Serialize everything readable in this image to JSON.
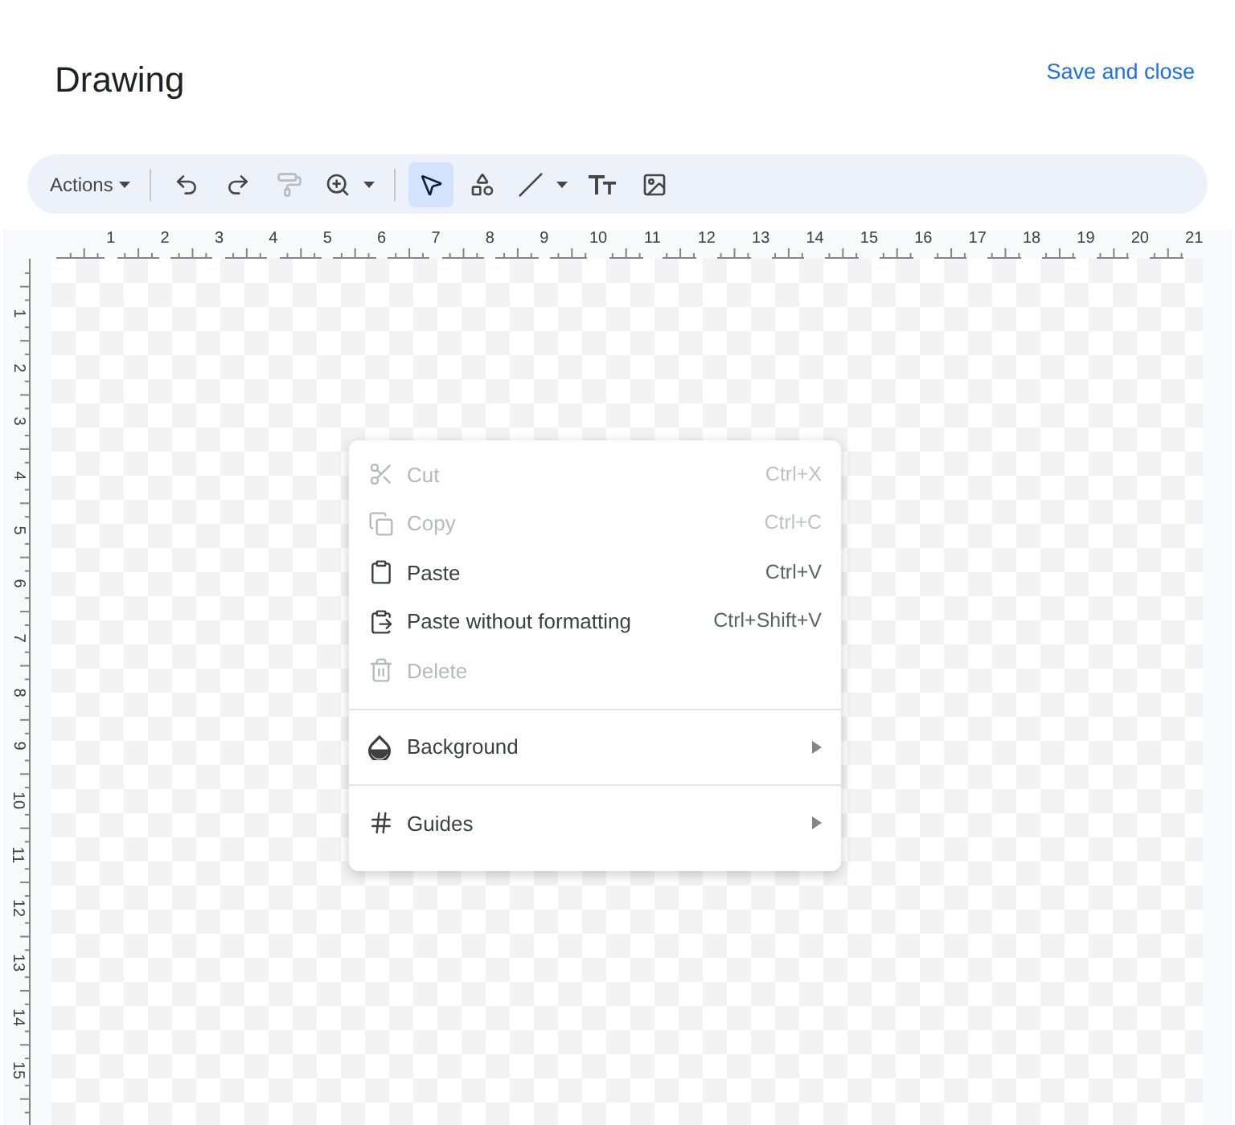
{
  "title": "Drawing",
  "save_button": "Save and close",
  "toolbar": [
    {
      "kind": "menu",
      "label": "Actions",
      "selected": false
    },
    {
      "kind": "undo",
      "selected": false
    },
    {
      "kind": "redo",
      "selected": false
    },
    {
      "kind": "paint",
      "disabled": true,
      "selected": false
    },
    {
      "kind": "zoom",
      "selected": false
    },
    {
      "kind": "select",
      "selected": true
    },
    {
      "kind": "shape",
      "selected": false
    },
    {
      "kind": "line",
      "selected": false
    },
    {
      "kind": "text",
      "selected": false
    },
    {
      "kind": "image",
      "selected": false
    }
  ],
  "top_ruler": [
    "1",
    "2",
    "3",
    "4",
    "5",
    "6",
    "7",
    "8",
    "9",
    "10",
    "11",
    "12",
    "13",
    "14",
    "15",
    "16",
    "17",
    "18",
    "19",
    "20",
    "21"
  ],
  "left_ruler": [
    "1",
    "2",
    "3",
    "4",
    "5",
    "6",
    "7",
    "8",
    "9",
    "10",
    "11",
    "12",
    "13",
    "14",
    "15"
  ],
  "context_menu": [
    [
      {
        "kind": "cut",
        "label": "Cut",
        "shortcut": "Ctrl+X",
        "disabled": true
      },
      {
        "kind": "copy",
        "label": "Copy",
        "shortcut": "Ctrl+C",
        "disabled": true
      },
      {
        "kind": "paste",
        "label": "Paste",
        "shortcut": "Ctrl+V",
        "disabled": false
      },
      {
        "kind": "paste-plain",
        "label": "Paste without formatting",
        "shortcut": "Ctrl+Shift+V",
        "disabled": false
      },
      {
        "kind": "delete",
        "label": "Delete",
        "disabled": true
      }
    ],
    [
      {
        "kind": "background",
        "label": "Background",
        "submenu": true,
        "disabled": false
      }
    ],
    [
      {
        "kind": "guides",
        "label": "Guides",
        "submenu": true,
        "disabled": false
      }
    ]
  ]
}
